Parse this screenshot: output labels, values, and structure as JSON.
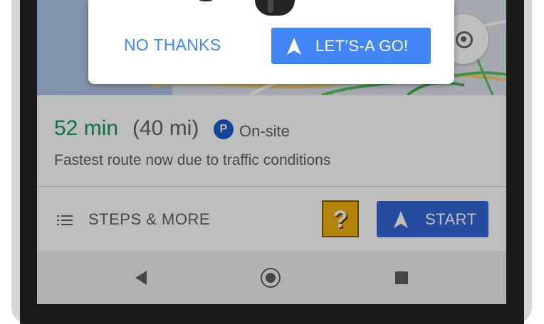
{
  "dialog": {
    "dismiss_label": "NO THANKS",
    "confirm_label": "LET’S-A GO!"
  },
  "route": {
    "eta": "52 min",
    "distance": "(40 mi)",
    "parking_badge": "P",
    "parking_label": "On-site",
    "note": "Fastest route now due to traffic conditions"
  },
  "actions": {
    "steps_label": "STEPS & MORE",
    "question_block": "?",
    "start_label": "START"
  },
  "colors": {
    "eta_green": "#0f9d58",
    "primary_blue": "#4285f4",
    "start_blue": "#3367d6",
    "parking_blue": "#1a5fd1",
    "question_block_yellow": "#f2b311"
  },
  "icons": {
    "locate": "my-location-icon",
    "steps": "list-icon",
    "navigate": "navigation-arrow-icon",
    "back": "back-icon",
    "home": "home-icon",
    "recents": "recents-icon"
  }
}
